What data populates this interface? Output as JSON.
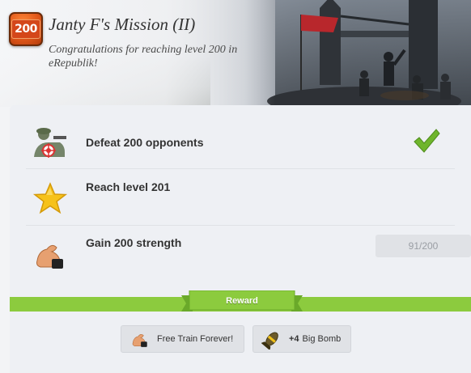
{
  "header": {
    "badge_level": "200",
    "title": "Janty F's Mission (II)",
    "subtitle": "Congratulations for reaching level 200 in eRepublik!"
  },
  "objectives": [
    {
      "label": "Defeat 200 opponents",
      "icon": "soldier-target-icon",
      "status": "completed"
    },
    {
      "label": "Reach level 201",
      "icon": "star-icon",
      "status": "incomplete"
    },
    {
      "label": "Gain 200 strength",
      "icon": "strength-arm-icon",
      "status": "incomplete",
      "progress": "91/200"
    }
  ],
  "reward": {
    "label": "Reward",
    "items": [
      {
        "label": "Free Train Forever!",
        "icon": "strength-arm-icon"
      },
      {
        "quantity": "+4",
        "label": "Big Bomb",
        "icon": "big-bomb-icon"
      }
    ]
  },
  "colors": {
    "accent_green": "#8ccb3e",
    "check_green": "#6fb52c",
    "badge_orange": "#e2581a"
  }
}
